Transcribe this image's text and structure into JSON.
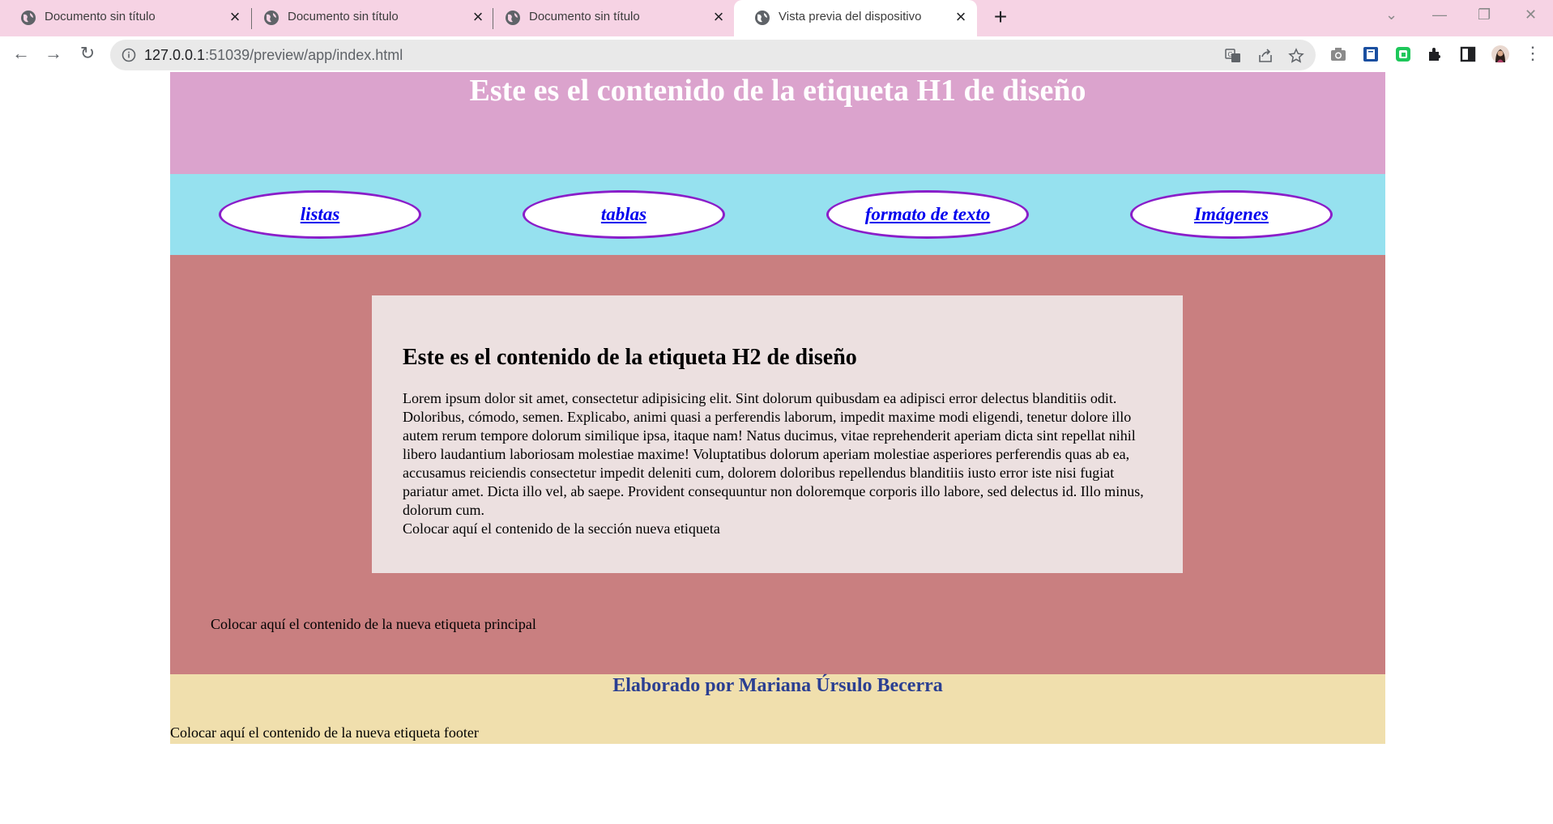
{
  "browser": {
    "tabs": [
      {
        "title": "Documento sin título",
        "active": false
      },
      {
        "title": "Documento sin título",
        "active": false
      },
      {
        "title": "Documento sin título",
        "active": false
      },
      {
        "title": "Vista previa del dispositivo",
        "active": true
      }
    ],
    "url_host": "127.0.0.1",
    "url_rest": ":51039/preview/app/index.html",
    "colors": {
      "tabstrip": "#f6d3e4",
      "omnibox": "#e9e9e9"
    }
  },
  "page": {
    "header": {
      "title": "Este es el contenido de la etiqueta H1 de diseño",
      "bg": "#dba3cd"
    },
    "nav": {
      "bg": "#96e1ef",
      "items": [
        {
          "label": "listas"
        },
        {
          "label": "tablas"
        },
        {
          "label": "formato de texto"
        },
        {
          "label": "Imágenes"
        }
      ]
    },
    "main": {
      "bg": "#c97f80",
      "article": {
        "heading": "Este es el contenido de la etiqueta H2 de diseño",
        "body": "Lorem ipsum dolor sit amet, consectetur adipisicing elit. Sint dolorum quibusdam ea adipisci error delectus blanditiis odit. Doloribus, cómodo, semen. Explicabo, animi quasi a perferendis laborum, impedit maxime modi eligendi, tenetur dolore illo autem rerum tempore dolorum similique ipsa, itaque nam! Natus ducimus, vitae reprehenderit aperiam dicta sint repellat nihil libero laudantium laboriosam molestiae maxime! Voluptatibus dolorum aperiam molestiae asperiores perferendis quas ab ea, accusamus reiciendis consectetur impedit deleniti cum, dolorem doloribus repellendus blanditiis iusto error iste nisi fugiat pariatur amet. Dicta illo vel, ab saepe. Provident consequuntur non doloremque corporis illo labore, sed delectus id. Illo minus, dolorum cum.",
        "section_note": "Colocar aquí el contenido de la sección nueva etiqueta"
      },
      "main_note": "Colocar aquí el contenido de la nueva etiqueta principal"
    },
    "footer": {
      "bg": "#f0dfad",
      "credit": "Elaborado por Mariana Úrsulo Becerra",
      "note": "Colocar aquí el contenido de la nueva etiqueta footer"
    }
  }
}
